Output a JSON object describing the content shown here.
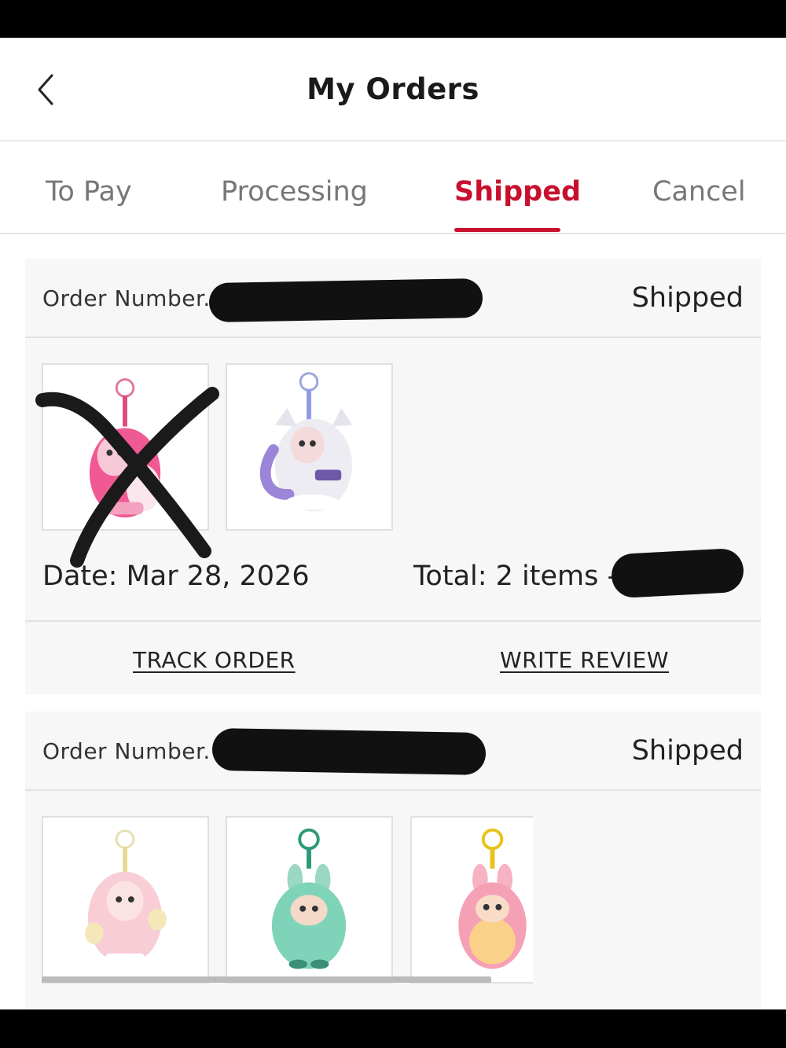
{
  "header": {
    "title": "My Orders",
    "back_icon": "chevron-left-icon"
  },
  "tabs": [
    {
      "label": "To Pay",
      "active": false
    },
    {
      "label": "Processing",
      "active": false
    },
    {
      "label": "Shipped",
      "active": true
    },
    {
      "label": "Cancel",
      "active": false
    }
  ],
  "colors": {
    "accent": "#c8102e",
    "card_bg": "#f7f7f7",
    "redaction": "#111111"
  },
  "orders": [
    {
      "order_label": "Order Number.",
      "status": "Shipped",
      "items": [
        {
          "name": "pink-plush-doll-keychain",
          "crossed_out": true
        },
        {
          "name": "lavender-plush-doll-keychain",
          "crossed_out": false
        }
      ],
      "date": "Date: Mar 28, 2026",
      "total": "Total: 2 items -",
      "actions": {
        "track": "TRACK ORDER",
        "review": "WRITE REVIEW"
      }
    },
    {
      "order_label": "Order Number.",
      "status": "Shipped",
      "items": [
        {
          "name": "pink-bunny-doll-keychain"
        },
        {
          "name": "mint-labubu-keychain"
        },
        {
          "name": "rainbow-labubu-keychain"
        }
      ]
    }
  ]
}
